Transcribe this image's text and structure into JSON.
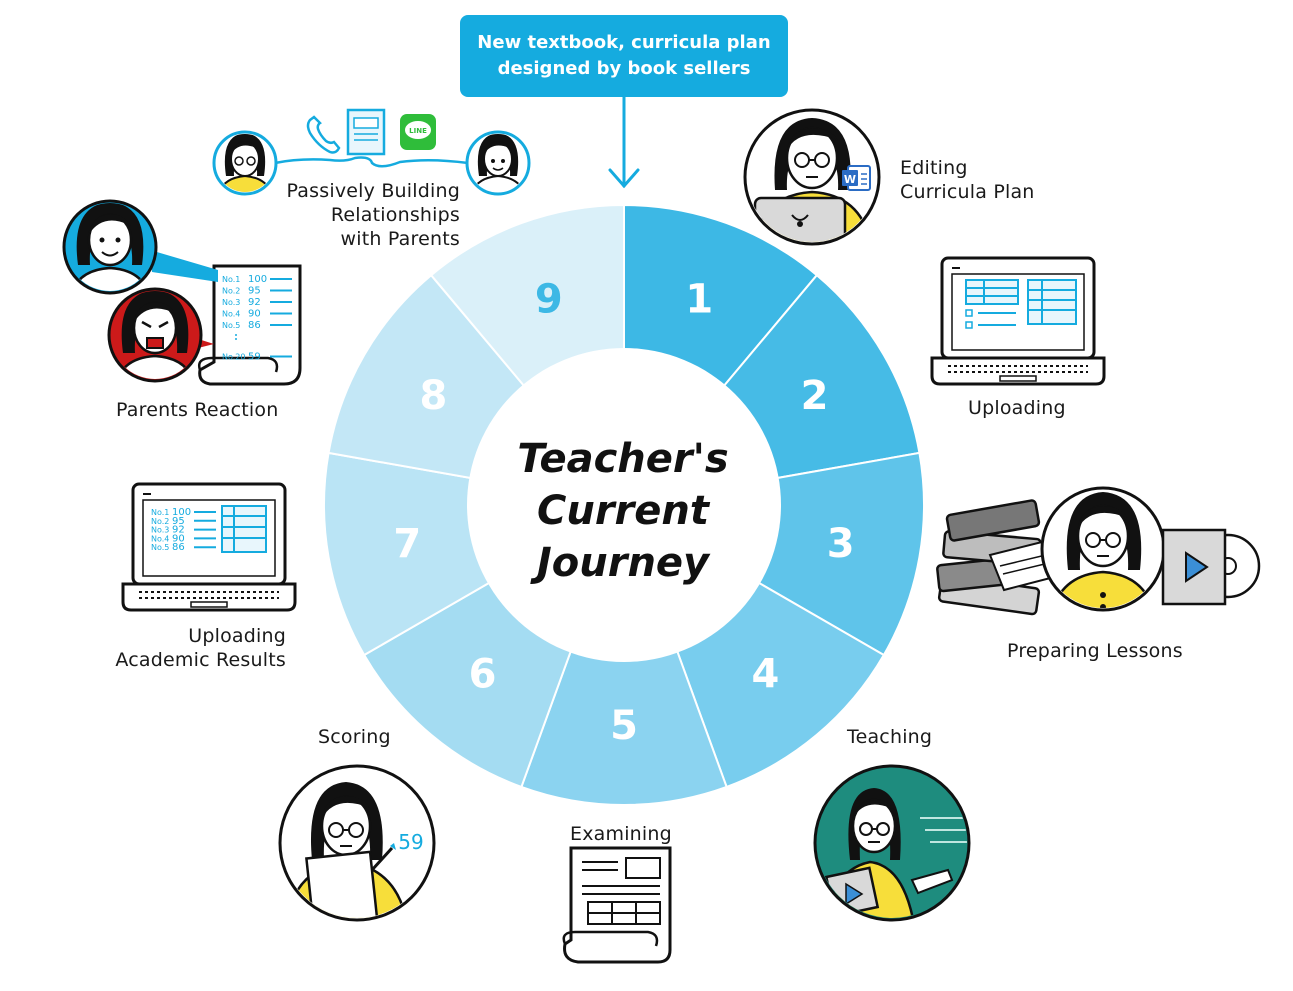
{
  "callout": {
    "line1": "New textbook, curricula plan",
    "line2": "designed by book sellers"
  },
  "center": {
    "line1": "Teacher's",
    "line2": "Current",
    "line3": "Journey"
  },
  "segments": [
    {
      "number": "1",
      "color": "#3db8e5"
    },
    {
      "number": "2",
      "color": "#46bbe6"
    },
    {
      "number": "3",
      "color": "#5fc4ea"
    },
    {
      "number": "4",
      "color": "#78cdee"
    },
    {
      "number": "5",
      "color": "#8bd3f0"
    },
    {
      "number": "6",
      "color": "#a4dcf2"
    },
    {
      "number": "7",
      "color": "#bae4f5"
    },
    {
      "number": "8",
      "color": "#c3e7f6"
    },
    {
      "number": "9",
      "color": "#daf0f9"
    }
  ],
  "steps": {
    "editing": {
      "line1": "Editing",
      "line2": "Curricula Plan"
    },
    "uploading": {
      "line1": "Uploading"
    },
    "preparing": {
      "line1": "Preparing Lessons"
    },
    "teaching": {
      "line1": "Teaching"
    },
    "examining": {
      "line1": "Examining"
    },
    "scoring": {
      "line1": "Scoring",
      "score": "59"
    },
    "uploading_results": {
      "line1": "Uploading",
      "line2": "Academic Results"
    },
    "parents_reaction": {
      "line1": "Parents Reaction"
    },
    "relationships": {
      "line1": "Passively Building",
      "line2": "Relationships",
      "line3": "with Parents"
    }
  },
  "score_list": {
    "labels": [
      "No.1",
      "No.2",
      "No.3",
      "No.4",
      "No.5",
      "No.20"
    ],
    "values": [
      "100",
      "95",
      "92",
      "90",
      "86",
      "59"
    ]
  },
  "laptop_list": {
    "labels": [
      "No.1",
      "No.2",
      "No.3",
      "No.4",
      "No.5"
    ],
    "values": [
      "100",
      "95",
      "92",
      "90",
      "86"
    ]
  },
  "line_icon_text": "LINE",
  "word_icon_text": "W",
  "colors": {
    "accent": "#15abdf",
    "yellow": "#f7de3a",
    "teal": "#1e8c7e",
    "red": "#cc1a1a"
  }
}
